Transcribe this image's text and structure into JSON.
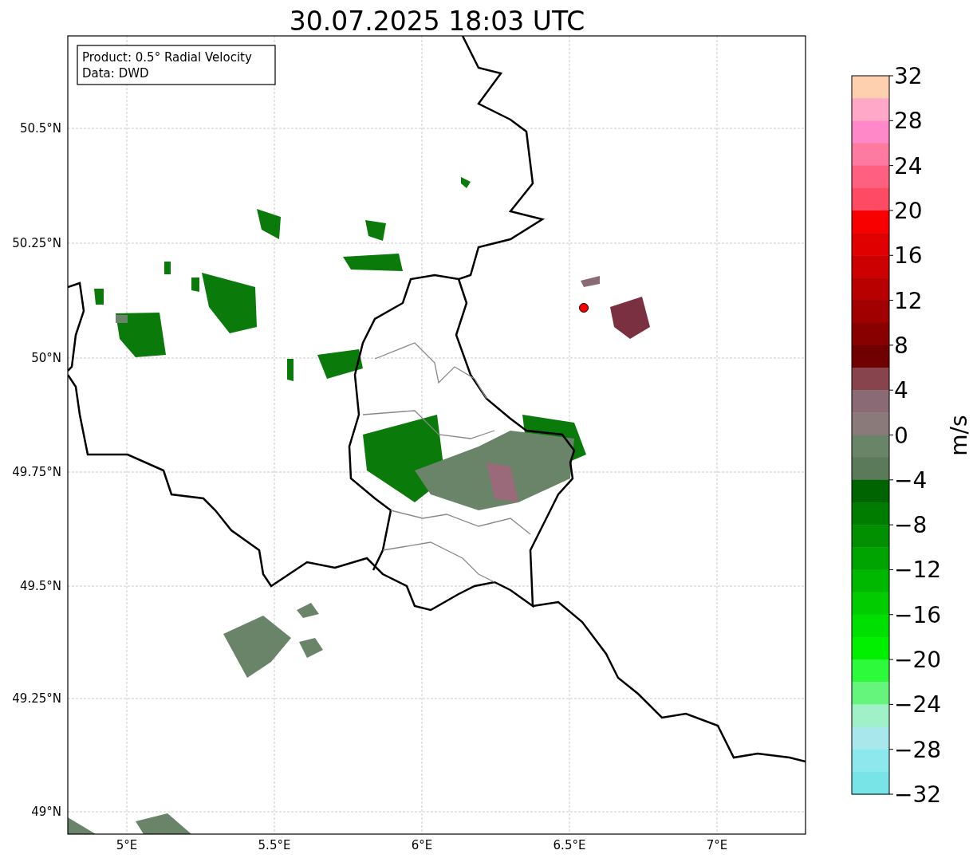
{
  "title": "30.07.2025 18:03 UTC",
  "info_box": [
    "Product: 0.5° Radial Velocity",
    "Data: DWD"
  ],
  "map": {
    "x_ticks": [
      "5°E",
      "5.5°E",
      "6°E",
      "6.5°E",
      "7°E"
    ],
    "y_ticks": [
      "50.5°N",
      "50.25°N",
      "50°N",
      "49.75°N",
      "49.5°N",
      "49.25°N",
      "49°N"
    ]
  },
  "colorbar": {
    "label": "m/s",
    "ticks": [
      "32",
      "28",
      "24",
      "20",
      "16",
      "12",
      "8",
      "4",
      "0",
      "−4",
      "−8",
      "−12",
      "−16",
      "−20",
      "−24",
      "−28",
      "−32"
    ],
    "segments": [
      {
        "color": "#ffd0b0"
      },
      {
        "color": "#ffa8c8"
      },
      {
        "color": "#ff88c8"
      },
      {
        "color": "#ff7aa0"
      },
      {
        "color": "#ff6080"
      },
      {
        "color": "#ff4a64"
      },
      {
        "color": "#f80000"
      },
      {
        "color": "#e00000"
      },
      {
        "color": "#cc0000"
      },
      {
        "color": "#b80000"
      },
      {
        "color": "#a00000"
      },
      {
        "color": "#880000"
      },
      {
        "color": "#700000"
      },
      {
        "color": "#88444c"
      },
      {
        "color": "#8a6a74"
      },
      {
        "color": "#8a7a7a"
      },
      {
        "color": "#6a846a"
      },
      {
        "color": "#5a7a5a"
      },
      {
        "color": "#006400"
      },
      {
        "color": "#007c00"
      },
      {
        "color": "#009000"
      },
      {
        "color": "#00a400"
      },
      {
        "color": "#00b800"
      },
      {
        "color": "#00cc00"
      },
      {
        "color": "#00e000"
      },
      {
        "color": "#00f000"
      },
      {
        "color": "#2efa3c"
      },
      {
        "color": "#66f57c"
      },
      {
        "color": "#a0f0c8"
      },
      {
        "color": "#a8e8ec"
      },
      {
        "color": "#8ce8ec"
      },
      {
        "color": "#78e4e8"
      }
    ]
  }
}
